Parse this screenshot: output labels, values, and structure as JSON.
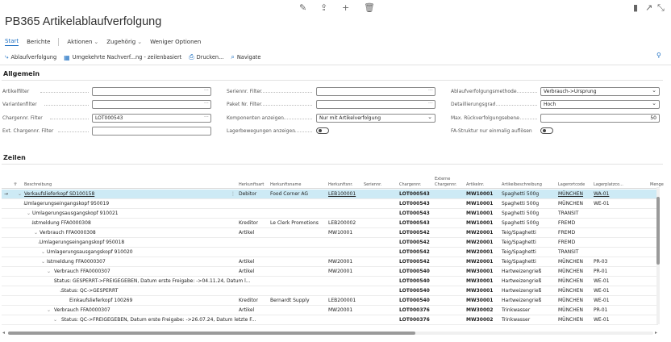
{
  "app": {
    "title": "PB365 Artikelablaufverfolgung"
  },
  "menu": {
    "items": [
      "Start",
      "Berichte",
      "Aktionen",
      "Zugehörig",
      "Weniger Optionen"
    ]
  },
  "actions": {
    "items": [
      "Ablaufverfolgung",
      "Umgekehrte Nachverf...ng - zeilenbasiert",
      "Drucken...",
      "Navigate"
    ]
  },
  "general": {
    "heading": "Allgemein",
    "col1": [
      {
        "label": "Artikelfilter",
        "value": ""
      },
      {
        "label": "Variantenfilter",
        "value": ""
      },
      {
        "label": "Chargennr. Filter",
        "value": "LOT000543"
      },
      {
        "label": "Ext. Chargennr. Filter",
        "value": ""
      }
    ],
    "col2": [
      {
        "label": "Seriennr. Filter",
        "value": ""
      },
      {
        "label": "Paket Nr. Filter",
        "value": ""
      },
      {
        "label": "Komponenten anzeigen",
        "value": "Nur mit Artikelverfolgung"
      },
      {
        "label": "Lagerbewegungen anzeigen",
        "value": ""
      }
    ],
    "col3": [
      {
        "label": "Ablaufverfolgungsmethode",
        "value": "Verbrauch->Ursprung"
      },
      {
        "label": "Detaillierungsgrad",
        "value": "Hoch"
      },
      {
        "label": "Max. Rückverfolgungsebene",
        "value": "50"
      },
      {
        "label": "FA-Struktur nur einmalig auflösen",
        "value": ""
      }
    ]
  },
  "lines": {
    "heading": "Zeilen",
    "columns": [
      "Beschreibung",
      "Herkunftsart",
      "Herkunftsname",
      "Herkunftsnr.",
      "Seriennr.",
      "Chargennr.",
      "Externe",
      "Chargennr.",
      "Artikelnr.",
      "Artikelbeschreibung",
      "Lagerortcode",
      "Lagerplatzco...",
      "Menge"
    ],
    "rows": [
      {
        "desc": "Verkaufslieferkopf SD100158",
        "type": "Debitor",
        "name": "Food Corner AG",
        "docno": "LEB100001",
        "lot": "LOT000543",
        "item": "MW10001",
        "itemdesc": "Spaghetti 500g",
        "loc": "MÜNCHEN",
        "bin": "WA-01"
      },
      {
        "desc": "Umlagerungseingangskopf 950019",
        "type": "",
        "name": "",
        "docno": "",
        "lot": "LOT000543",
        "item": "MW10001",
        "itemdesc": "Spaghetti 500g",
        "loc": "MÜNCHEN",
        "bin": "WE-01"
      },
      {
        "desc": "Umlagerungsausgangskopf 910021",
        "type": "",
        "name": "",
        "docno": "",
        "lot": "LOT000543",
        "item": "MW10001",
        "itemdesc": "Spaghetti 500g",
        "loc": "TRANSIT",
        "bin": ""
      },
      {
        "desc": "Istmeldung FFA0000308",
        "type": "Kreditor",
        "name": "Le Clerk Promotions",
        "docno": "LEB200002",
        "lot": "LOT000543",
        "item": "MW10001",
        "itemdesc": "Spaghetti 500g",
        "loc": "FREMD",
        "bin": ""
      },
      {
        "desc": "Verbrauch FFA0000308",
        "type": "Artikel",
        "name": "",
        "docno": "MW10001",
        "lot": "LOT000542",
        "item": "MW20001",
        "itemdesc": "Teig/Spaghetti",
        "loc": "FREMD",
        "bin": ""
      },
      {
        "desc": "Umlagerungseingangskopf 950018",
        "type": "",
        "name": "",
        "docno": "",
        "lot": "LOT000542",
        "item": "MW20001",
        "itemdesc": "Teig/Spaghetti",
        "loc": "FREMD",
        "bin": ""
      },
      {
        "desc": "Umlagerungsausgangskopf 910020",
        "type": "",
        "name": "",
        "docno": "",
        "lot": "LOT000542",
        "item": "MW20001",
        "itemdesc": "Teig/Spaghetti",
        "loc": "TRANSIT",
        "bin": ""
      },
      {
        "desc": "Istmeldung FFA0000307",
        "type": "Artikel",
        "name": "",
        "docno": "MW20001",
        "lot": "LOT000542",
        "item": "MW20001",
        "itemdesc": "Teig/Spaghetti",
        "loc": "MÜNCHEN",
        "bin": "PR-03"
      },
      {
        "desc": "Verbrauch FFA0000307",
        "type": "Artikel",
        "name": "",
        "docno": "MW20001",
        "lot": "LOT000540",
        "item": "MW30001",
        "itemdesc": "Hartweizengrieß",
        "loc": "MÜNCHEN",
        "bin": "PR-01"
      },
      {
        "desc": "Status: GESPERRT->FREIGEGEBEN, Datum erste Freigabe: ->04.11.24, Datum l...",
        "type": "",
        "name": "",
        "docno": "",
        "lot": "LOT000540",
        "item": "MW30001",
        "itemdesc": "Hartweizengrieß",
        "loc": "MÜNCHEN",
        "bin": "WE-01"
      },
      {
        "desc": "Status: QC->GESPERRT",
        "type": "",
        "name": "",
        "docno": "",
        "lot": "LOT000540",
        "item": "MW30001",
        "itemdesc": "Hartweizengrieß",
        "loc": "MÜNCHEN",
        "bin": "WE-01"
      },
      {
        "desc": "Einkaufslieferkopf 100269",
        "type": "Kreditor",
        "name": "Bernardt Supply",
        "docno": "LEB200001",
        "lot": "LOT000540",
        "item": "MW30001",
        "itemdesc": "Hartweizengrieß",
        "loc": "MÜNCHEN",
        "bin": "WE-01"
      },
      {
        "desc": "Verbrauch FFA0000307",
        "type": "Artikel",
        "name": "",
        "docno": "MW20001",
        "lot": "LOT000376",
        "item": "MW30002",
        "itemdesc": "Trinkwasser",
        "loc": "MÜNCHEN",
        "bin": "PR-01"
      },
      {
        "desc": "Status: QC->FREIGEGEBEN, Datum erste Freigabe: ->26.07.24, Datum letzte F...",
        "type": "",
        "name": "",
        "docno": "",
        "lot": "LOT000376",
        "item": "MW30002",
        "itemdesc": "Trinkwasser",
        "loc": "MÜNCHEN",
        "bin": "WE-01"
      }
    ]
  }
}
